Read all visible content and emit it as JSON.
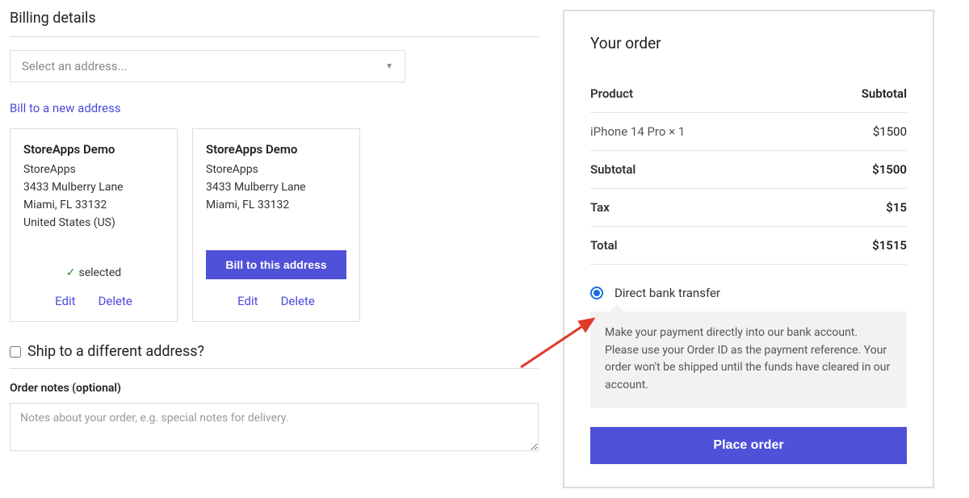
{
  "billing": {
    "title": "Billing details",
    "select_placeholder": "Select an address...",
    "new_address_link": "Bill to a new address",
    "selected_text": "selected",
    "bill_to_btn": "Bill to this address",
    "edit": "Edit",
    "delete": "Delete",
    "addresses": [
      {
        "title": "StoreApps Demo",
        "line1": "StoreApps",
        "line2": "3433 Mulberry Lane",
        "line3": "Miami, FL 33132",
        "line4": "United States (US)"
      },
      {
        "title": "StoreApps Demo",
        "line1": "StoreApps",
        "line2": "3433 Mulberry Lane",
        "line3": "Miami, FL 33132",
        "line4": ""
      }
    ]
  },
  "ship_different_label": "Ship to a different address?",
  "notes": {
    "label": "Order notes (optional)",
    "placeholder": "Notes about your order, e.g. special notes for delivery."
  },
  "order": {
    "title": "Your order",
    "product_header": "Product",
    "subtotal_header": "Subtotal",
    "product_name": "iPhone 14 Pro  × 1",
    "product_price": "$1500",
    "subtotal_label": "Subtotal",
    "subtotal_value": "$1500",
    "tax_label": "Tax",
    "tax_value": "$15",
    "total_label": "Total",
    "total_value": "$1515",
    "payment_method": "Direct bank transfer",
    "payment_desc": "Make your payment directly into our bank account. Please use your Order ID as the payment reference. Your order won't be shipped until the funds have cleared in our account.",
    "place_order": "Place order"
  }
}
